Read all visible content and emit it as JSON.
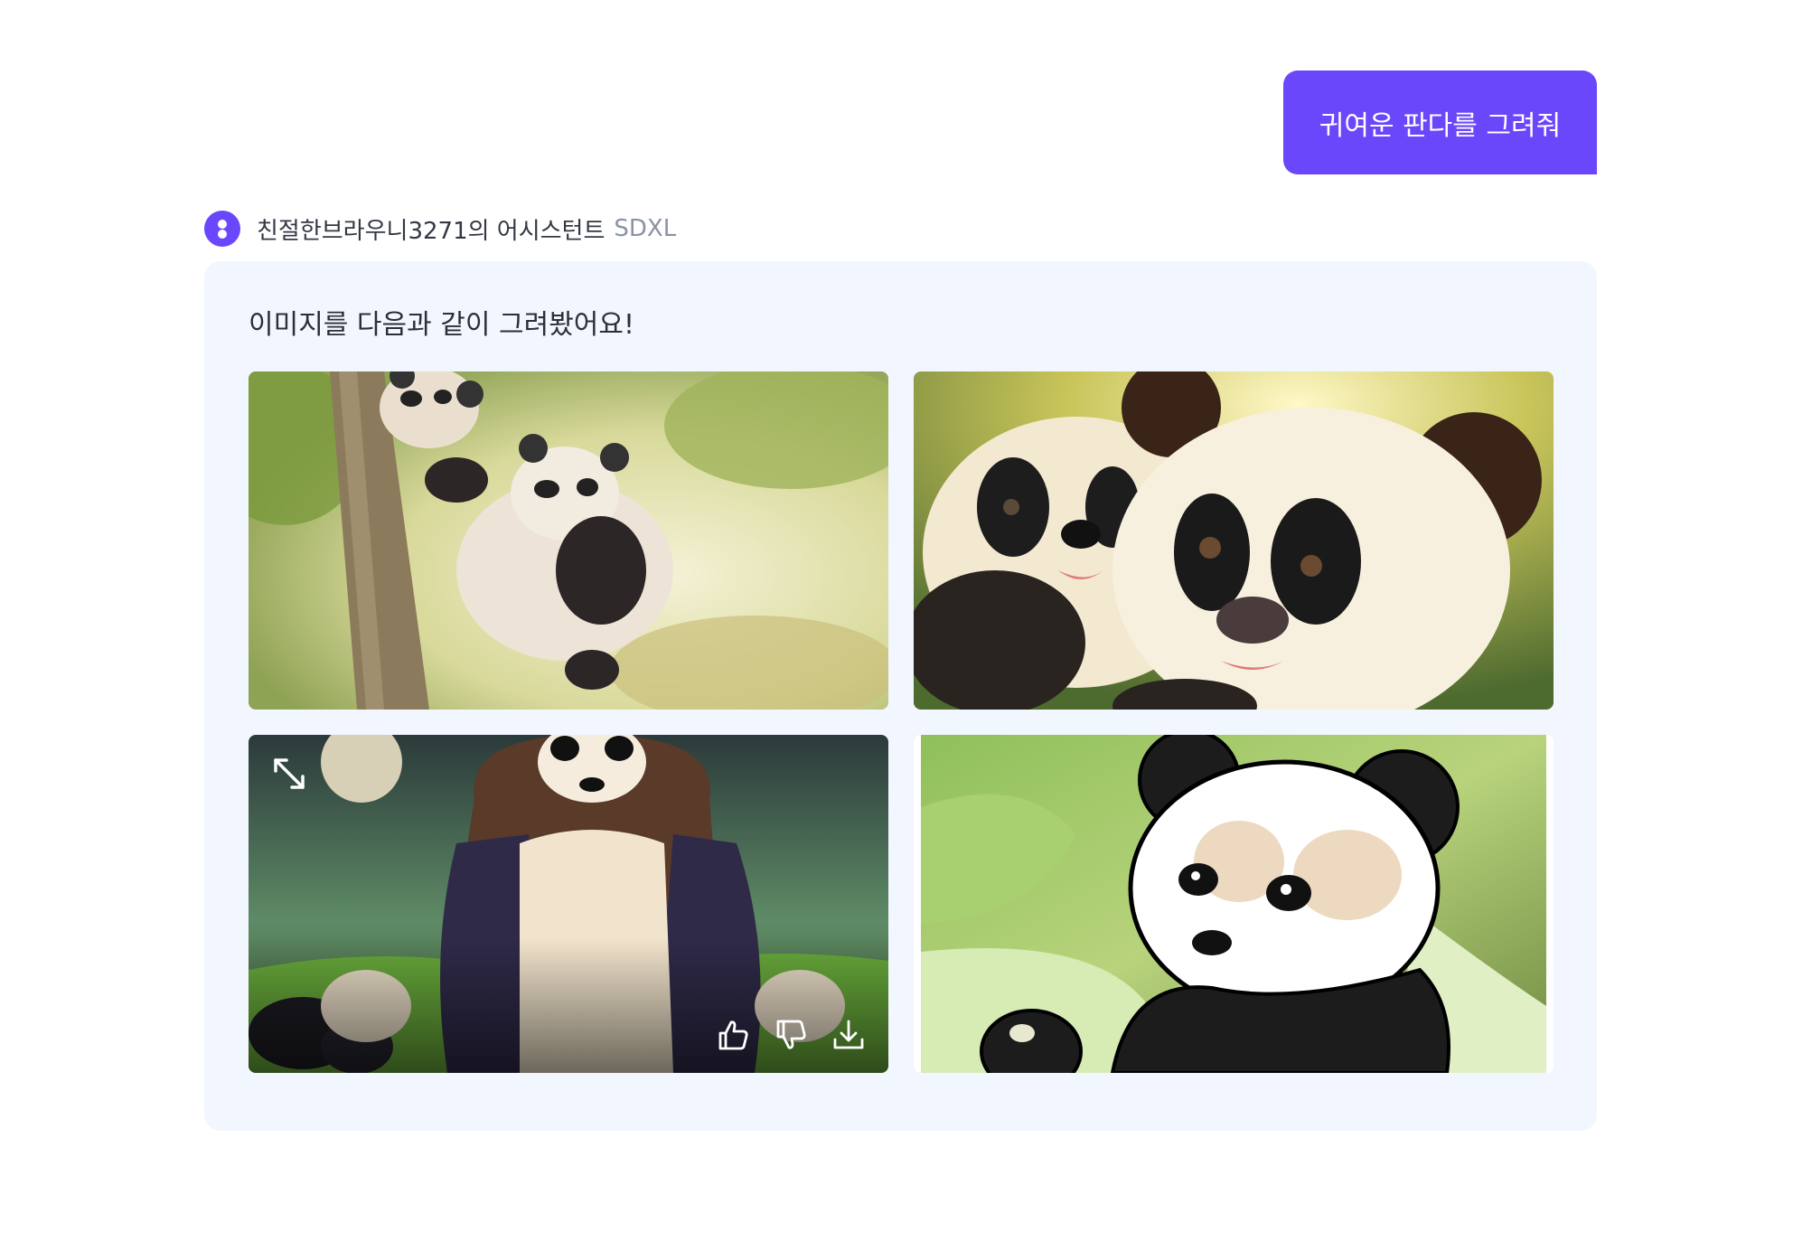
{
  "user_message": {
    "text": "귀여운 판다를 그려줘"
  },
  "assistant": {
    "name": "친절한브라우니3271의 어시스턴트",
    "model": "SDXL",
    "response_text": "이미지를 다음과 같이 그려봤어요!",
    "images": [
      {
        "icon": "panda-climbing-tree-image"
      },
      {
        "icon": "two-fluffy-pandas-image"
      },
      {
        "icon": "panda-sitting-forest-image"
      },
      {
        "icon": "cartoon-panda-image"
      }
    ]
  },
  "colors": {
    "accent": "#6a47fb",
    "card_background": "#f2f6fe",
    "model_tag": "#8a92a6"
  }
}
